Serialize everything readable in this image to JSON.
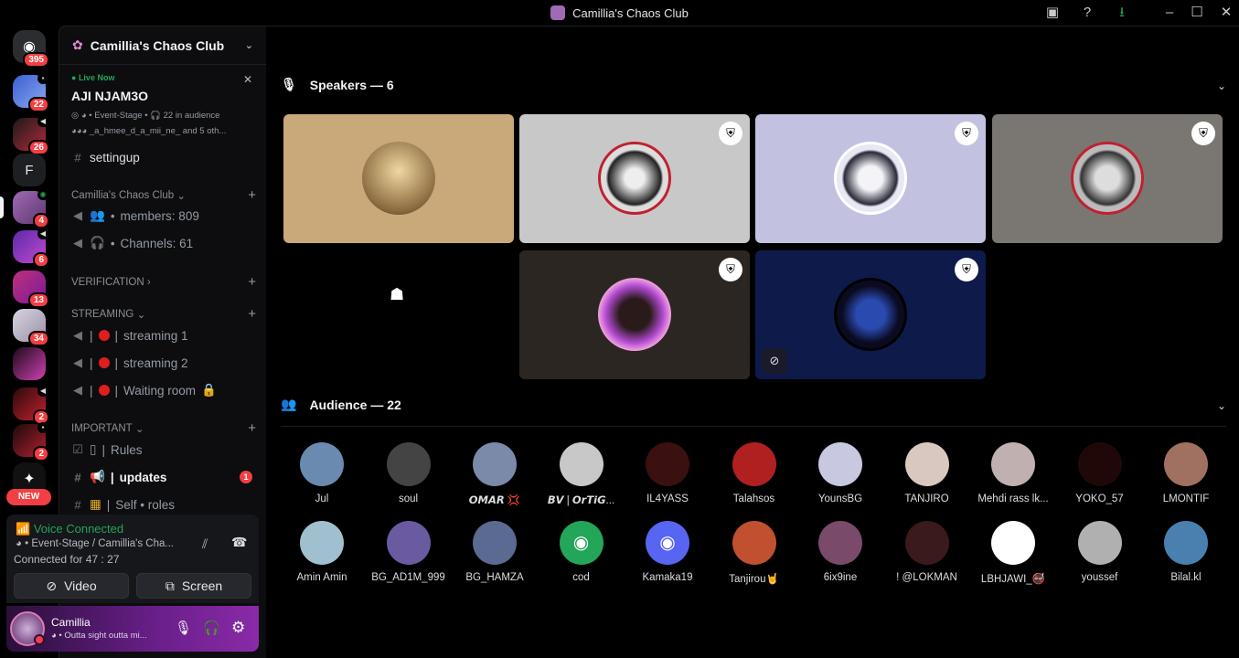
{
  "window": {
    "title": "Camillia's Chaos Club"
  },
  "rail": {
    "servers": [
      {
        "badge": "395"
      },
      {
        "badge": "22"
      },
      {
        "badge": "26"
      },
      {
        "letter": "F"
      },
      {
        "badge": "4"
      },
      {
        "badge": "6"
      },
      {
        "badge": "13"
      },
      {
        "badge": "34"
      },
      {
        "badge": ""
      },
      {
        "badge": "2"
      },
      {
        "badge": "2"
      },
      {
        "badge": ""
      }
    ],
    "new_label": "NEW"
  },
  "server": {
    "name": "Camillia's Chaos Club"
  },
  "live": {
    "status": "Live Now",
    "title": "AJI NJAM3O",
    "meta": "Event-Stage • 🎧 22 in audience",
    "participants": "_a_hmee_d_a_mii_ne_ and 5 oth..."
  },
  "channels": {
    "top": "settingup",
    "category1": "Camillia's Chaos Club",
    "members": "members: 809",
    "channels_count": "Channels: 61",
    "verification": "VERIFICATION",
    "streaming_cat": "STREAMING",
    "streaming1": "streaming 1",
    "streaming2": "streaming 2",
    "waiting": "Waiting room",
    "important": "IMPORTANT",
    "rules": "Rules",
    "updates": "updates",
    "updates_badge": "1",
    "roles": "Self • roles"
  },
  "voice": {
    "status": "Voice Connected",
    "location": "Event-Stage / Camillia's Cha...",
    "connected": "Connected for 47 : 27",
    "video_label": "Video",
    "screen_label": "Screen"
  },
  "user": {
    "name": "Camillia",
    "status": "• Outta sight outta mi..."
  },
  "speakers": {
    "header": "Speakers — 6"
  },
  "audience": {
    "header": "Audience — 22",
    "row1": [
      "Jul",
      "soul",
      "𝙊𝙈𝘼𝙍 💢",
      "𝘽𝙑 | 𝙊𝙧𝙏𝙞𝙂...",
      "IL4YASS",
      "Talahsos",
      "YounsBG",
      "TANJIRO",
      "Mehdi rass lk...",
      "YOKO_57",
      "LMONTIF"
    ],
    "row2": [
      "Amin Amin",
      "BG_AD1M_999",
      "BG_HAMZA",
      "cod",
      "Kamaka19",
      "Tanjirou🤘",
      "6ix9ine",
      "! @LOKMAN",
      "LBHJAWI_🚭",
      "youssef",
      "Bilal.kl"
    ]
  },
  "colors": {
    "accent_green": "#23a55a",
    "danger_red": "#f23f43",
    "bg": "#000000"
  }
}
